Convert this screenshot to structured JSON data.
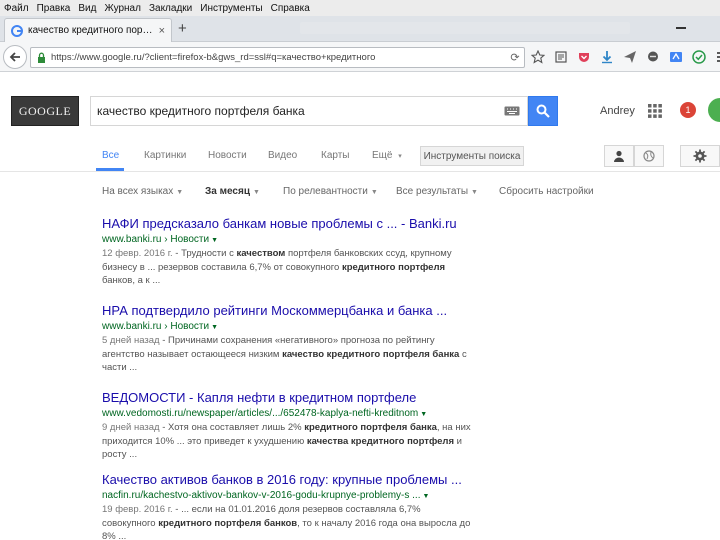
{
  "menubar": {
    "items": [
      "Файл",
      "Правка",
      "Вид",
      "Журнал",
      "Закладки",
      "Инструменты",
      "Справка"
    ]
  },
  "browser": {
    "tab_title": "качество кредитного пор…",
    "tab_close": "×",
    "new_tab": "+",
    "url": "https://www.google.ru/?client=firefox-b&gws_rd=ssl#q=качество+кредитного",
    "reload": "⟳"
  },
  "header": {
    "logo": "GOOGLE",
    "query": "качество кредитного портфеля банка",
    "username": "Andrey",
    "notification_count": "1"
  },
  "search_tabs": {
    "items": [
      "Все",
      "Картинки",
      "Новости",
      "Видео",
      "Карты",
      "Ещё"
    ],
    "more_caret": "▾",
    "tools_label": "Инструменты поиска"
  },
  "filters": {
    "language": "На всех языках",
    "period": "За месяц",
    "sort": "По релевантности",
    "results": "Все результаты",
    "reset": "Сбросить настройки",
    "caret": "▼"
  },
  "results": [
    {
      "title": "НАФИ предсказало банкам новые проблемы с ... - Banki.ru",
      "url": "www.banki.ru › Новости",
      "date": "12 февр. 2016 г.",
      "snippet": [
        [
          " - Трудности с ",
          "качеством",
          " портфеля банковских ссуд, крупному"
        ],
        [
          "бизнесу в ... резервов составила 6,7% от совокупного ",
          "кредитного портфеля",
          ""
        ],
        [
          "банков, а к ...",
          "",
          ""
        ]
      ]
    },
    {
      "title": "НРА подтвердило рейтинги Москоммерцбанка и банка ...",
      "url": "www.banki.ru › Новости",
      "date": "5 дней назад",
      "snippet": [
        [
          " - Причинами сохранения «негативного» прогноза по рейтингу",
          "",
          ""
        ],
        [
          "агентство называет остающееся низким ",
          "качество кредитного портфеля банка",
          " с"
        ],
        [
          "части ...",
          "",
          ""
        ]
      ]
    },
    {
      "title": "ВЕДОМОСТИ - Капля нефти в кредитном портфеле",
      "url": "www.vedomosti.ru/newspaper/articles/.../652478-kaplya-nefti-kreditnom",
      "date": "9 дней назад",
      "snippet": [
        [
          " - Хотя она составляет лишь 2% ",
          "кредитного портфеля банка",
          ", на них"
        ],
        [
          "приходится 10% ... это приведет к ухудшению ",
          "качества кредитного портфеля",
          " и"
        ],
        [
          "росту ...",
          "",
          ""
        ]
      ]
    },
    {
      "title": "Качество активов банков в 2016 году: крупные проблемы ...",
      "url": "nacfin.ru/kachestvo-aktivov-bankov-v-2016-godu-krupnye-problemy-s ...",
      "date": "19 февр. 2016 г.",
      "snippet": [
        [
          " - ... если на 01.01.2016 доля резервов составляла 6,7%",
          "",
          ""
        ],
        [
          "совокупного ",
          "кредитного портфеля банков",
          ", то к началу 2016 года она выросла до"
        ],
        [
          "8% ...",
          "",
          ""
        ]
      ]
    }
  ]
}
